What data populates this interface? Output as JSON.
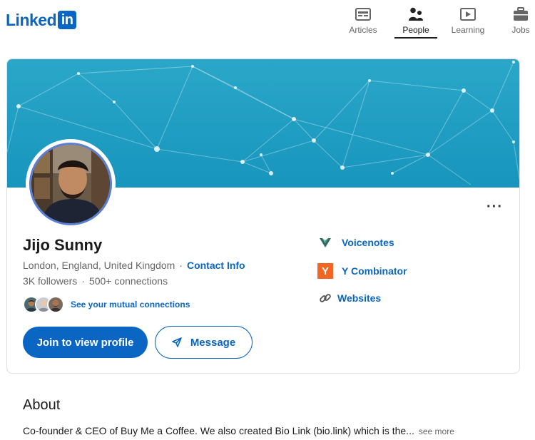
{
  "brand": {
    "logo_word": "Linked",
    "logo_box": "in",
    "color": "#0a66c2"
  },
  "nav": [
    {
      "label": "Articles",
      "icon": "articles-icon",
      "active": false
    },
    {
      "label": "People",
      "icon": "people-icon",
      "active": true
    },
    {
      "label": "Learning",
      "icon": "learning-icon",
      "active": false
    },
    {
      "label": "Jobs",
      "icon": "briefcase-icon",
      "active": false
    }
  ],
  "profile": {
    "name": "Jijo Sunny",
    "location": "London, England, United Kingdom",
    "location_sep": "·",
    "contact_info": "Contact Info",
    "followers": "3K followers",
    "stats_sep": "·",
    "connections": "500+ connections",
    "mutual": "See your mutual connections",
    "more_menu": "···"
  },
  "actions": {
    "join": "Join to view profile",
    "message": "Message"
  },
  "links": [
    {
      "label": "Voicenotes",
      "icon": "voicenotes-icon"
    },
    {
      "label": "Y Combinator",
      "icon": "y-combinator-icon",
      "icon_text": "Y",
      "icon_color": "#f26522"
    },
    {
      "label": "Websites",
      "icon": "link-icon"
    }
  ],
  "about": {
    "title": "About",
    "text": "Co-founder & CEO of Buy Me a Coffee. We also created Bio Link (bio.link) which is the...",
    "see_more": "see more"
  }
}
